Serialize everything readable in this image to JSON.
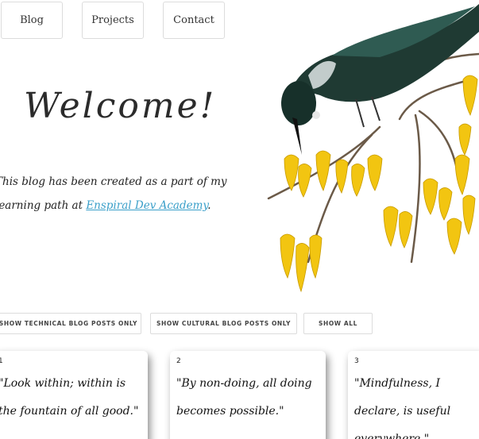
{
  "nav": {
    "blog": "Blog",
    "projects": "Projects",
    "contact": "Contact"
  },
  "hero": {
    "title": "Welcome!",
    "intro_text": "This blog has been created as a part of my learning path at ",
    "academy_link": "Enspiral Dev Academy",
    "intro_end": "."
  },
  "filters": {
    "technical": "SHOW TECHNICAL BLOG POSTS ONLY",
    "cultural": "SHOW CULTURAL BLOG POSTS ONLY",
    "all": "SHOW ALL"
  },
  "cards": [
    {
      "number": "1",
      "quote": "\"Look within; within is the fountain of all good.\""
    },
    {
      "number": "2",
      "quote": "\"By non-doing, all doing becomes possible.\""
    },
    {
      "number": "3",
      "quote": "\"Mindfulness, I declare, is useful everywhere.\""
    }
  ],
  "colors": {
    "link": "#3a9fc9",
    "flower": "#f2c511",
    "bird": "#1f3a33"
  }
}
